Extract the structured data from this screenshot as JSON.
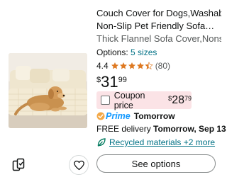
{
  "product": {
    "title_line1": "Couch Cover for Dogs,Washable",
    "title_line2": "Non-Slip Pet Friendly Sofa…",
    "subtitle": "Thick Flannel Sofa Cover,Nons…",
    "options_label": "Options:",
    "options_link": "5 sizes",
    "rating": "4.4",
    "rating_stars": 4.4,
    "review_count": "(80)",
    "price_symbol": "$",
    "price_whole": "31",
    "price_fraction": "99",
    "coupon_label": "Coupon price",
    "coupon_symbol": "$",
    "coupon_whole": "28",
    "coupon_fraction": "79",
    "prime_label": "Prime",
    "prime_day": "Tomorrow",
    "delivery_prefix": "FREE delivery",
    "delivery_date": "Tomorrow, Sep 13",
    "recycled_text": "Recycled materials +2 more",
    "see_options_label": "See options"
  },
  "colors": {
    "coupon_bg": "#fbe3e6",
    "link": "#007185",
    "star": "#de7921",
    "prime_blue": "#1399ff",
    "prime_orange": "#f3a847",
    "leaf_green": "#067d62"
  },
  "icons": {
    "compare": "compare-icon",
    "wishlist": "heart-icon",
    "prime_check": "prime-check-icon",
    "recycled": "leaf-icon",
    "star": "star-icon"
  }
}
